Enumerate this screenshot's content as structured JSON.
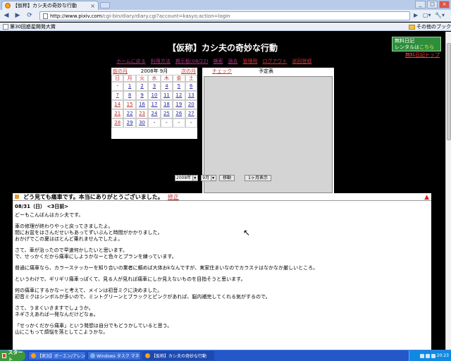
{
  "browser": {
    "tab_title": "【仮称】カシ夫の奇妙な行動",
    "tab_close": "×",
    "url_host": "http://www.pixiv.com",
    "url_path": "/cgi-bin/diary/diary.cgi?account=kasyo;action=login",
    "bookmark_1": "第30回惑星開発大賞",
    "bookmark_other": "その他のブックマーク",
    "nav_back": "◀",
    "nav_forward": "▶",
    "nav_reload": "⟳",
    "go_btn": "▶",
    "page_menu": "▢▾",
    "tools_menu": "🔧▾",
    "min": "_",
    "max": "□",
    "close": "×"
  },
  "site": {
    "title": "【仮称】カシ夫の奇妙な行動",
    "rental_line1": "無料日記",
    "rental_line2_a": "レンタルは",
    "rental_line2_b": "こちら",
    "rental_link": "無料日記トップ"
  },
  "nav": {
    "home": "ホームに戻る",
    "usage": "利用方法",
    "bbs": "掲示板(08/22)",
    "search": "検索",
    "archive": "過去",
    "admin": "管理用",
    "logout": "ログアウト",
    "register": "巡回登録"
  },
  "calendar": {
    "prev": "前の月",
    "current": "2008年 9月",
    "next": "次の月",
    "weekdays": [
      "日",
      "月",
      "火",
      "水",
      "木",
      "金",
      "土"
    ],
    "days": [
      "-",
      "1",
      "2",
      "3",
      "4",
      "5",
      "6",
      "7",
      "8",
      "9",
      "10",
      "11",
      "12",
      "13",
      "14",
      "15",
      "16",
      "17",
      "18",
      "19",
      "20",
      "21",
      "22",
      "23",
      "24",
      "25",
      "26",
      "27",
      "28",
      "29",
      "30",
      "-",
      "-",
      "-",
      "-"
    ]
  },
  "schedule": {
    "check": "チェック",
    "title": "予定表"
  },
  "month_select": {
    "year": "2008年",
    "month": "9月",
    "move_btn": "移動",
    "one_month_btn": "1ヶ月表示"
  },
  "entry": {
    "title": "どう見ても痛車です。本当にありがとうございました。",
    "edit": "修正",
    "warn": "▲",
    "date": "08/31（日） <3日前>",
    "paragraphs": [
      "どーもこんばんはカシ夫です。",
      "車の修理が終わりやっと戻ってきましたよ。\n間にお盆をはさんだせいもあってずいぶんと時間がかかりました。\nおかげでこの夏はほとんど乗れませんでしたよ。",
      "",
      "さて、車が治ったので早速何かしたいと思います。\nで、せっかくだから痛車にしようかなーと色々とプランを練っています。",
      "普通に痛車なら、カラーステッカーを知り合いの業者に頼めば大体おkなんですが、実家住まいなのでカラステはなかなか厳しいところ。",
      "というわけで、ギリギリ痛車っぽくて、見る人が見れば痛車にしか見えないものを目指そうと思います。",
      "何の痛車にするかなーと考えて、メインは初音ミクに決めました。\n初音ミクはシンボルが多いので、ミントグリーンとブラックとピンクがあれば、脳内補完してくれる気がするので。",
      "さて、うまくいきますでしょうか。\nネギさえあれば一発なんだけどなぁ。",
      "",
      "「せっかくだから痛車」という発想は自分でもどうかしていると思う。\n山にこもって煩悩を落としてこようかな。"
    ]
  },
  "cursor": "↖",
  "taskbar": {
    "start": "スタート",
    "item_1": "【実況】ボーエン/アレングメ...",
    "item_2": "Windows タスク マネージャ",
    "item_3": "【仮称】カシ夫の奇妙な行動",
    "clock": "20:23"
  }
}
